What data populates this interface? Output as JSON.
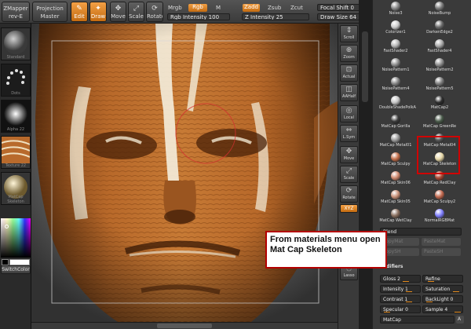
{
  "toolbar": {
    "zmapper": "ZMapper",
    "zmapper_rev": "rev-E",
    "projection_master": "Projection Master",
    "edit": "Edit",
    "draw": "Draw",
    "move": "Move",
    "scale": "Scale",
    "rotate": "Rotate",
    "mrgb": "Mrgb",
    "rgb": "Rgb",
    "m": "M",
    "rgb_intensity": "Rgb Intensity 100",
    "zadd": "Zadd",
    "zsub": "Zsub",
    "zcut": "Zcut",
    "z_intensity": "Z Intensity 25",
    "focal_shift": "Focal Shift 0",
    "draw_size": "Draw Size 64",
    "accent_color": "#e88a1a"
  },
  "left_shelf": {
    "items": [
      {
        "label": "Standard"
      },
      {
        "label": "Dots"
      },
      {
        "label": "Alpha 22"
      },
      {
        "label": "Texture 22"
      },
      {
        "label": "MatCap Skeleton"
      }
    ],
    "switch_color": "SwitchColor"
  },
  "right_shelf": {
    "buttons": [
      {
        "label": "Scroll",
        "icon": "scroll-icon",
        "glyph": "⇕"
      },
      {
        "label": "Zoom",
        "icon": "zoom-icon",
        "glyph": "⊕"
      },
      {
        "label": "Actual",
        "icon": "actual-icon",
        "glyph": "⊡"
      },
      {
        "label": "AAHalf",
        "icon": "aahalf-icon",
        "glyph": "◫"
      },
      {
        "label": "Local",
        "icon": "local-icon",
        "glyph": "◎"
      },
      {
        "label": "L.Sym",
        "icon": "lsym-icon",
        "glyph": "⇔"
      },
      {
        "label": "Move",
        "icon": "move-icon",
        "glyph": "✥"
      },
      {
        "label": "Scale",
        "icon": "scale-icon",
        "glyph": "⤢"
      },
      {
        "label": "Rotate",
        "icon": "rotate-icon",
        "glyph": "⟳"
      },
      {
        "label": "XYZ",
        "icon": "xyz-icon",
        "glyph": ""
      },
      {
        "label": "Lasso",
        "icon": "lasso-icon",
        "glyph": "◌"
      }
    ]
  },
  "materials": [
    {
      "name": "Noise3",
      "color": "#8a8a8a"
    },
    {
      "name": "NoiseBump",
      "color": "#7b7b7b"
    },
    {
      "name": "Colorizer1",
      "color": "#cccccc"
    },
    {
      "name": "DarkenEdge2",
      "color": "#6a6a6a"
    },
    {
      "name": "FastShader2",
      "color": "#b5b5b5"
    },
    {
      "name": "FastShader4",
      "color": "#a9a9a9"
    },
    {
      "name": "NoisePattern1",
      "color": "#8d8d8d"
    },
    {
      "name": "NoisePattern2",
      "color": "#8f8f8f"
    },
    {
      "name": "NoisePattern4",
      "color": "#858585"
    },
    {
      "name": "NoisePattern5",
      "color": "#7f7f7f"
    },
    {
      "name": "DoubleShadePolkA",
      "color": "#c5c5c5"
    },
    {
      "name": "MatCap2",
      "color": "#2d2d2d"
    },
    {
      "name": "MatCap Gorilla",
      "color": "#3a3a3a"
    },
    {
      "name": "MatCap GreenRe",
      "color": "#4a5a4a"
    },
    {
      "name": "MatCap Metal01",
      "color": "#9a9a9a"
    },
    {
      "name": "MatCap Metal04",
      "color": "#555555"
    },
    {
      "name": "MatCap Sculpy",
      "color": "#c4704c"
    },
    {
      "name": "MatCap Skeleton",
      "color": "#e6d7a8"
    },
    {
      "name": "MatCap Skin06",
      "color": "#d08a70"
    },
    {
      "name": "MatCap RedClay",
      "color": "#a94a35"
    },
    {
      "name": "MatCap Skin05",
      "color": "#c89078"
    },
    {
      "name": "MatCap Sculpy2",
      "color": "#c36a50"
    },
    {
      "name": "MatCap WetClay",
      "color": "#8a7060"
    },
    {
      "name": "NormalRGBMat",
      "color": "#8080ff"
    }
  ],
  "panel": {
    "blend_label": "Blend",
    "copy_mat": "CopyMat",
    "paste_mat": "PasteMat",
    "copy_sh": "CopySH",
    "paste_sh": "PasteSH",
    "modifiers": "Modifiers",
    "gloss": "Gloss 2",
    "refine": "Refine",
    "intensity": "Intensity 1",
    "saturation": "Saturation",
    "contrast": "Contrast 1",
    "backlight": "BackLight 0",
    "specular": "Specular 0",
    "sample": "Sample 4",
    "matcap": "MatCap",
    "a": "A"
  },
  "callout": {
    "line1": "From materials menu open",
    "line2": "Mat Cap Skeleton"
  }
}
